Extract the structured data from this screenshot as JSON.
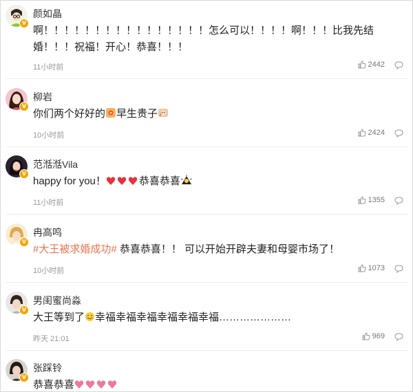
{
  "colors": {
    "accent": "#eb7350",
    "badge": "#f7a400",
    "heart": "#e8323c",
    "pink_heart": "#f0779c"
  },
  "comments": [
    {
      "name": "颜如晶",
      "line1": "啊！！！！！！！！！！！！！！！！怎么可以！！！！啊！！！比我先结",
      "line2": "婚！！！祝福！开心！恭喜！！！",
      "time": "11小时前",
      "likes": "2442"
    },
    {
      "name": "柳岩",
      "text_a": "你们两个好好的",
      "text_b": "早生贵子",
      "time": "10小时前",
      "likes": "2424"
    },
    {
      "name": "范湉湉Vila",
      "text_a": "happy for you！",
      "text_b": "恭喜恭喜",
      "time": "11小时前",
      "likes": "1355"
    },
    {
      "name": "冉高鸣",
      "tag": "#大王被求婚成功#",
      "text": " 恭喜恭喜！！ 可以开始开辟夫妻和母婴市场了！",
      "time": "10小时前",
      "likes": "1073"
    },
    {
      "name": "男闺蜜尚淼",
      "text_a": "大王等到了",
      "text_b": "幸福幸福幸福幸福幸福幸福…………………",
      "time": "昨天 21:01",
      "likes": "969"
    },
    {
      "name": "张踩铃",
      "text_a": "恭喜恭喜"
    }
  ]
}
